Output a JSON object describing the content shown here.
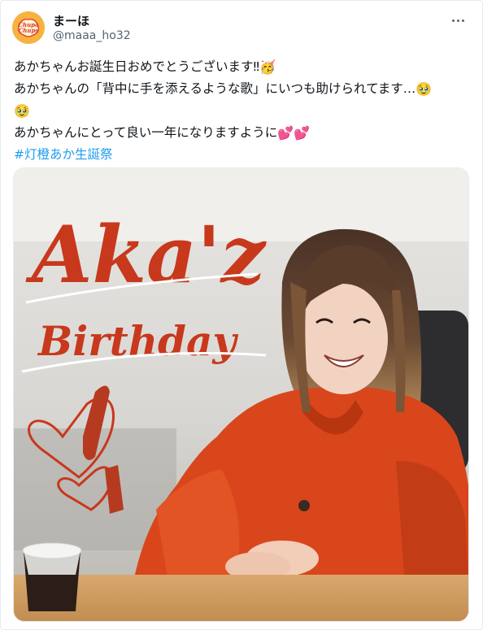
{
  "user": {
    "name": "まーほ",
    "handle": "@maaa_ho32",
    "avatar_icon": "chupa-chups-logo-icon",
    "avatar_logo_text": "Chupa Chups"
  },
  "tweet": {
    "line1": "あかちゃんお誕生日おめでとうございます‼",
    "line1_emoji": "🥳",
    "line2": "あかちゃんの「背中に手を添えるような歌」にいつも助けられてます…",
    "line2_emoji": "🥹",
    "line3_emoji": "🥹",
    "line4": "あかちゃんにとって良い一年になりますように",
    "line4_emoji": "💕💕",
    "hashtag": "#灯橙あか生誕祭"
  },
  "media": {
    "title_text": "Aka'z",
    "subtitle_text": "Birthday",
    "accent_color": "#c8381c",
    "jacket_color": "#d9461c"
  },
  "more_icon": "more-dots-icon"
}
